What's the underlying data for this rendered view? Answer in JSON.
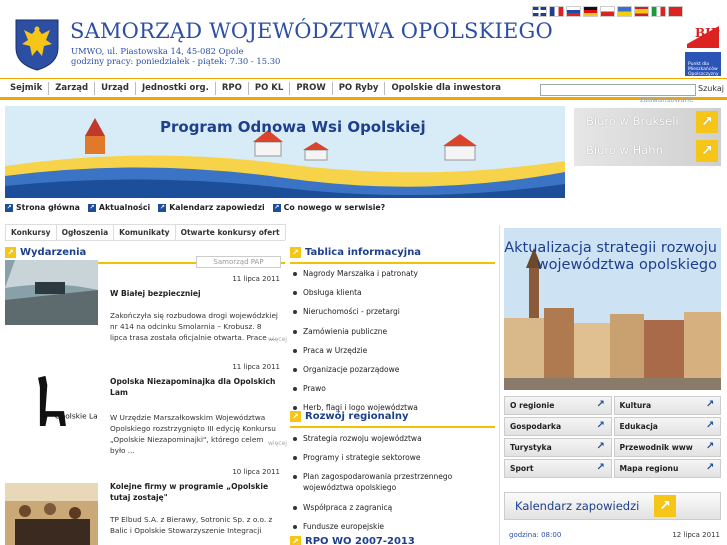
{
  "header": {
    "title": "SAMORZĄD WOJEWÓDZTWA OPOLSKIEGO",
    "address": "UMWO, ul. Piastowska 14, 45-082 Opole",
    "hours": "godziny pracy: poniedziałek - piątek: 7.30 - 15.30",
    "bip_label": "BIP",
    "eu_label": "Punkt dla Mieszkańców Opolszczyzny"
  },
  "flags": [
    "gb-flag",
    "fr-flag",
    "ru-flag",
    "de-flag",
    "cz-flag",
    "ua-flag",
    "es-flag",
    "it-flag",
    "cn-flag"
  ],
  "topnav": [
    "Sejmik",
    "Zarząd",
    "Urząd",
    "Jednostki org.",
    "RPO",
    "PO KL",
    "PROW",
    "PO Ryby",
    "Opolskie dla inwestora"
  ],
  "search": {
    "button": "Szukaj",
    "advanced": "zaawansowane"
  },
  "banner": {
    "text": "Program Odnowa Wsi Opolskiej"
  },
  "side_buttons": [
    "Biuro w Brukseli",
    "Biuro w Hahn"
  ],
  "quick_links": [
    "Strona główna",
    "Aktualności",
    "Kalendarz zapowiedzi",
    "Co nowego w serwisie?"
  ],
  "tabs": [
    "Konkursy",
    "Ogłoszenia",
    "Komunikaty",
    "Otwarte konkursy ofert"
  ],
  "wydarzenia": {
    "heading": "Wydarzenia",
    "source": "Samorząd PAP",
    "items": [
      {
        "date": "11 lipca 2011",
        "title": "W Białej bezpieczniej",
        "body": "Zakończyła się rozbudowa drogi wojewódzkiej nr 414 na odcinku Smolarnia – Krobusz. 8 lipca trasa została oficjalnie otwarta. Prace ..."
      },
      {
        "date": "11 lipca 2011",
        "title": "Opolska Niezapominajka dla Opolskich Lam",
        "body": "W Urzędzie Marszałkowskim Województwa Opolskiego rozstrzygnięto III edycję Konkursu „Opolskie Niezapominajki\", którego celem było ..."
      },
      {
        "date": "10 lipca 2011",
        "title": "Kolejne firmy w programie „Opolskie tutaj zostaję\"",
        "body": "TP Elbud S.A. z Bierawy, Sotronic Sp. z o.o. z Balic i Opolskie Stowarzyszenie Integracji"
      }
    ],
    "more": "więcej",
    "lamy_logo_text": "Opolskie Lamy"
  },
  "tablica": {
    "heading": "Tablica informacyjna",
    "items": [
      "Nagrody Marszałka i patronaty",
      "Obsługa klienta",
      "Nieruchomości - przetargi",
      "Zamówienia publiczne",
      "Praca w Urzędzie",
      "Organizacje pozarządowe",
      "Prawo",
      "Herb, flagi i logo województwa"
    ]
  },
  "rozwoj": {
    "heading": "Rozwój regionalny",
    "items": [
      "Strategia rozwoju województwa",
      "Programy i strategie sektorowe",
      "Plan zagospodarowania przestrzennego województwa opolskiego",
      "Współpraca z zagranicą",
      "Fundusze europejskie"
    ]
  },
  "rpo_heading": "RPO WO 2007-2013",
  "aktualizacja": "Aktualizacja strategii rozwoju województwa opolskiego",
  "region_links": [
    "O regionie",
    "Kultura",
    "Gospodarka",
    "Edukacja",
    "Turystyka",
    "Przewodnik www",
    "Sport",
    "Mapa regionu"
  ],
  "kalendarz": {
    "label": "Kalendarz zapowiedzi",
    "time": "godzina: 08:00",
    "date": "12 lipca 2011"
  }
}
